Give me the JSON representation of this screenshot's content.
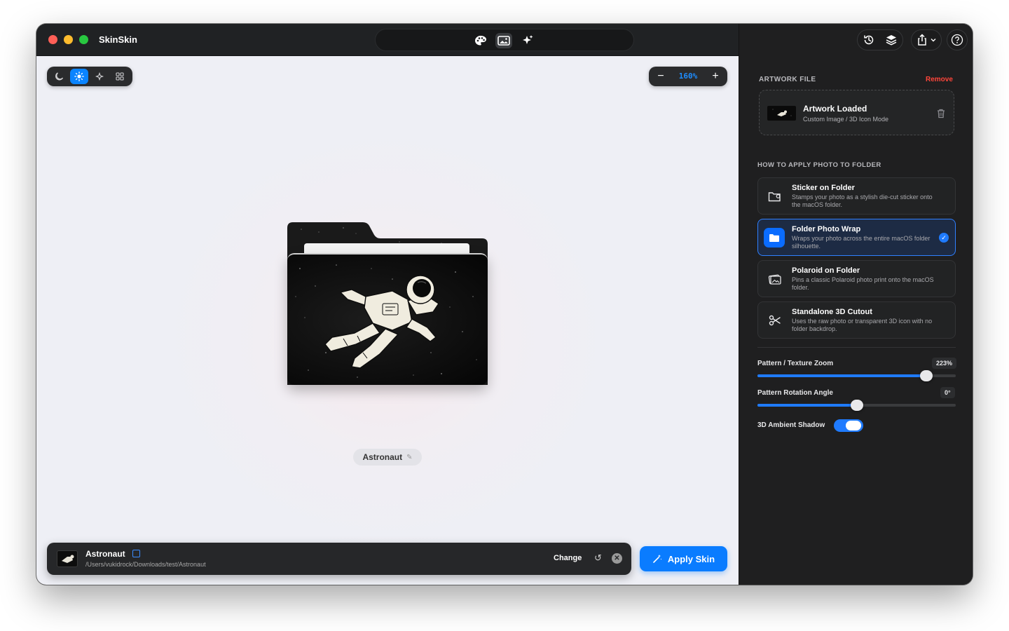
{
  "app": {
    "title": "SkinSkin"
  },
  "canvas": {
    "zoom": "160%",
    "folder_name": "Astronaut"
  },
  "file_bar": {
    "name": "Astronaut",
    "path": "/Users/vukidrock/Downloads/test/Astronaut",
    "change_label": "Change"
  },
  "apply": {
    "label": "Apply Skin"
  },
  "panel": {
    "artwork_section": "ARTWORK FILE",
    "remove_label": "Remove",
    "artwork_title": "Artwork Loaded",
    "artwork_sub": "Custom Image / 3D Icon Mode",
    "apply_section": "HOW TO APPLY PHOTO TO FOLDER",
    "options": [
      {
        "title": "Sticker on Folder",
        "desc": "Stamps your photo as a stylish die-cut sticker onto the macOS folder.",
        "selected": false
      },
      {
        "title": "Folder Photo Wrap",
        "desc": "Wraps your photo across the entire macOS folder silhouette.",
        "selected": true
      },
      {
        "title": "Polaroid on Folder",
        "desc": "Pins a classic Polaroid photo print onto the macOS folder.",
        "selected": false
      },
      {
        "title": "Standalone 3D Cutout",
        "desc": "Uses the raw photo or transparent 3D icon with no folder backdrop.",
        "selected": false
      }
    ],
    "pattern_zoom_label": "Pattern / Texture Zoom",
    "pattern_zoom_value": "223%",
    "pattern_zoom_level": 0.85,
    "rotation_label": "Pattern Rotation Angle",
    "rotation_value": "0°",
    "rotation_level": 0.5,
    "shadow_label": "3D Ambient Shadow",
    "shadow_on": true
  },
  "colors": {
    "accent": "#0a7cff",
    "remove": "#ff453a",
    "panel_bg": "#1f1f20"
  }
}
